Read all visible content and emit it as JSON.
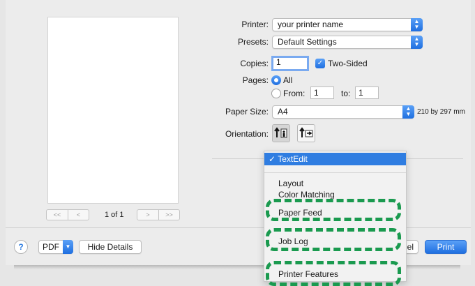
{
  "printer": {
    "label": "Printer:",
    "value": "your printer name"
  },
  "presets": {
    "label": "Presets:",
    "value": "Default Settings"
  },
  "copies": {
    "label": "Copies:",
    "value": "1",
    "two_sided_label": "Two-Sided",
    "two_sided_checked": true
  },
  "pages": {
    "label": "Pages:",
    "all_label": "All",
    "from_label": "From:",
    "from_value": "1",
    "to_label": "to:",
    "to_value": "1"
  },
  "paper_size": {
    "label": "Paper Size:",
    "value": "A4",
    "dimensions": "210 by 297 mm"
  },
  "orientation": {
    "label": "Orientation:"
  },
  "preview": {
    "page_indicator": "1 of 1",
    "first": "<<",
    "prev": "<",
    "next": ">",
    "last": ">>"
  },
  "menu": {
    "selected": "TextEdit",
    "check": "✓",
    "items": [
      "Layout",
      "Color Matching",
      "Paper Feed",
      "Job Log",
      "Printer Features"
    ]
  },
  "footer": {
    "help": "?",
    "pdf": "PDF",
    "hide_details": "Hide Details",
    "cancel_fragment": "el",
    "print": "Print"
  },
  "colors": {
    "accent": "#2f7de1",
    "highlight": "#1a9a4f"
  }
}
